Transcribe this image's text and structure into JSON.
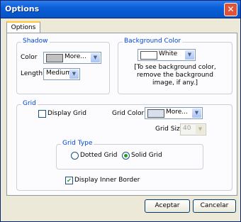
{
  "window": {
    "title": "Options",
    "close_icon": "close-icon"
  },
  "tab": {
    "label": "Options"
  },
  "shadow": {
    "group_label": "Shadow",
    "color_label": "Color",
    "color_value": "More...",
    "color_swatch": "#c0c0c0",
    "length_label": "Length",
    "length_value": "Medium"
  },
  "background": {
    "group_label": "Background Color",
    "color_value": "White",
    "color_swatch": "#ffffff",
    "note_line1": "[To see background color,",
    "note_line2": "remove the background",
    "note_line3": "image, if any.]"
  },
  "grid": {
    "group_label": "Grid",
    "display_grid_label": "Display Grid",
    "display_grid_checked": false,
    "grid_color_label": "Grid Color",
    "grid_color_value": "More...",
    "grid_color_swatch": "#d8e0f0",
    "grid_size_label": "Grid Size",
    "grid_size_value": "40",
    "grid_type": {
      "group_label": "Grid Type",
      "dotted_label": "Dotted Grid",
      "solid_label": "Solid Grid",
      "selected": "Solid Grid"
    }
  },
  "display_inner_border": {
    "label": "Display Inner Border",
    "checked": true
  },
  "buttons": {
    "ok": "Aceptar",
    "cancel": "Cancelar"
  }
}
